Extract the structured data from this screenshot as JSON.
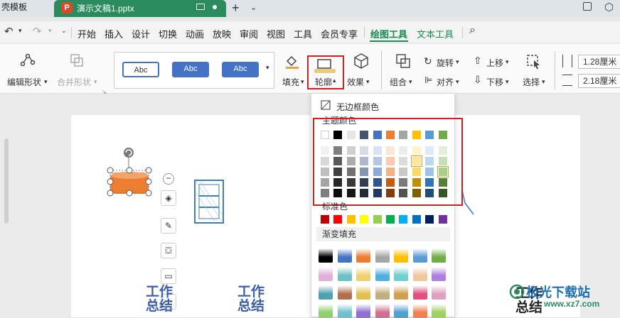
{
  "titlebar": {
    "templates_tab": "壳模板",
    "doc_title": "演示文稿1.pptx"
  },
  "menu": {
    "items": [
      "开始",
      "插入",
      "设计",
      "切换",
      "动画",
      "放映",
      "审阅",
      "视图",
      "工具",
      "会员专享",
      "绘图工具",
      "文本工具"
    ]
  },
  "ribbon": {
    "edit_shape": "编辑形状",
    "merge_shape": "合并形状",
    "style_samples": [
      "Abc",
      "Abc",
      "Abc"
    ],
    "fill": "填充",
    "outline": "轮廓",
    "effects": "效果",
    "group": "组合",
    "rotate": "旋转",
    "align": "对齐",
    "move_up": "上移",
    "move_down": "下移",
    "select": "选择",
    "width_value": "1.28厘米",
    "height_value": "2.18厘米"
  },
  "dropdown": {
    "no_border": "无边框颜色",
    "theme_colors": "主题颜色",
    "standard_colors": "标准色",
    "gradient_fill": "渐变填充",
    "theme_top_row": [
      "#ffffff",
      "#000000",
      "#e7e6e6",
      "#44546a",
      "#4472c4",
      "#ed7d31",
      "#a5a5a5",
      "#ffc000",
      "#5b9bd5",
      "#70ad47"
    ],
    "theme_shades": [
      [
        "#f2f2f2",
        "#7f7f7f",
        "#d0cece",
        "#d6dce4",
        "#d9e2f3",
        "#fbe5d5",
        "#ededed",
        "#fff2cc",
        "#deebf6",
        "#e2efd9"
      ],
      [
        "#d8d8d8",
        "#595959",
        "#aeabab",
        "#adb9ca",
        "#b4c6e7",
        "#f7cbac",
        "#dbdbdb",
        "#fee599",
        "#bdd7ee",
        "#c5e0b3"
      ],
      [
        "#bfbfbf",
        "#3f3f3f",
        "#757070",
        "#8496b0",
        "#8eaadb",
        "#f4b183",
        "#c9c9c9",
        "#ffd965",
        "#9dc3e6",
        "#a8d08d"
      ],
      [
        "#a5a5a5",
        "#262626",
        "#3a3838",
        "#323f4f",
        "#2f5496",
        "#c55a11",
        "#7b7b7b",
        "#bf9000",
        "#2e75b5",
        "#538135"
      ],
      [
        "#7f7f7f",
        "#0c0c0c",
        "#171616",
        "#222a35",
        "#1f3864",
        "#833c0b",
        "#525252",
        "#7f6000",
        "#1e4e79",
        "#375623"
      ]
    ],
    "standard": [
      "#c00000",
      "#ff0000",
      "#ffc000",
      "#ffff00",
      "#92d050",
      "#00b050",
      "#00b0f0",
      "#0070c0",
      "#002060",
      "#7030a0"
    ],
    "gradients": [
      [
        "#000000",
        "#4472c4",
        "#ed7d31",
        "#a5a5a5",
        "#ffc000",
        "#5b9bd5",
        "#70ad47"
      ],
      [
        "#e0b0d8",
        "#70c0c8",
        "#f0d070",
        "#50b0e0",
        "#70d0d0",
        "#f0c8a0",
        "#b080e0"
      ],
      [
        "#50a0b0",
        "#b07050",
        "#e0c050",
        "#c0b080",
        "#d0a050",
        "#e05080",
        "#e0a0c0"
      ],
      [
        "#90d070",
        "#70c0d0",
        "#9070d0",
        "#d07090",
        "#50a0d0",
        "#f08050",
        "#a0d060"
      ]
    ]
  },
  "slide": {
    "text_blocks": [
      "工作总结",
      "工作总结",
      "工作总结"
    ],
    "watermark": "极光下载站",
    "watermark_url": "www.xz7.com"
  },
  "colors": {
    "brand_green": "#1b8a55",
    "tab_green": "#2a8c5e",
    "highlight_red": "#d42020",
    "shape_orange": "#ed7d31"
  }
}
